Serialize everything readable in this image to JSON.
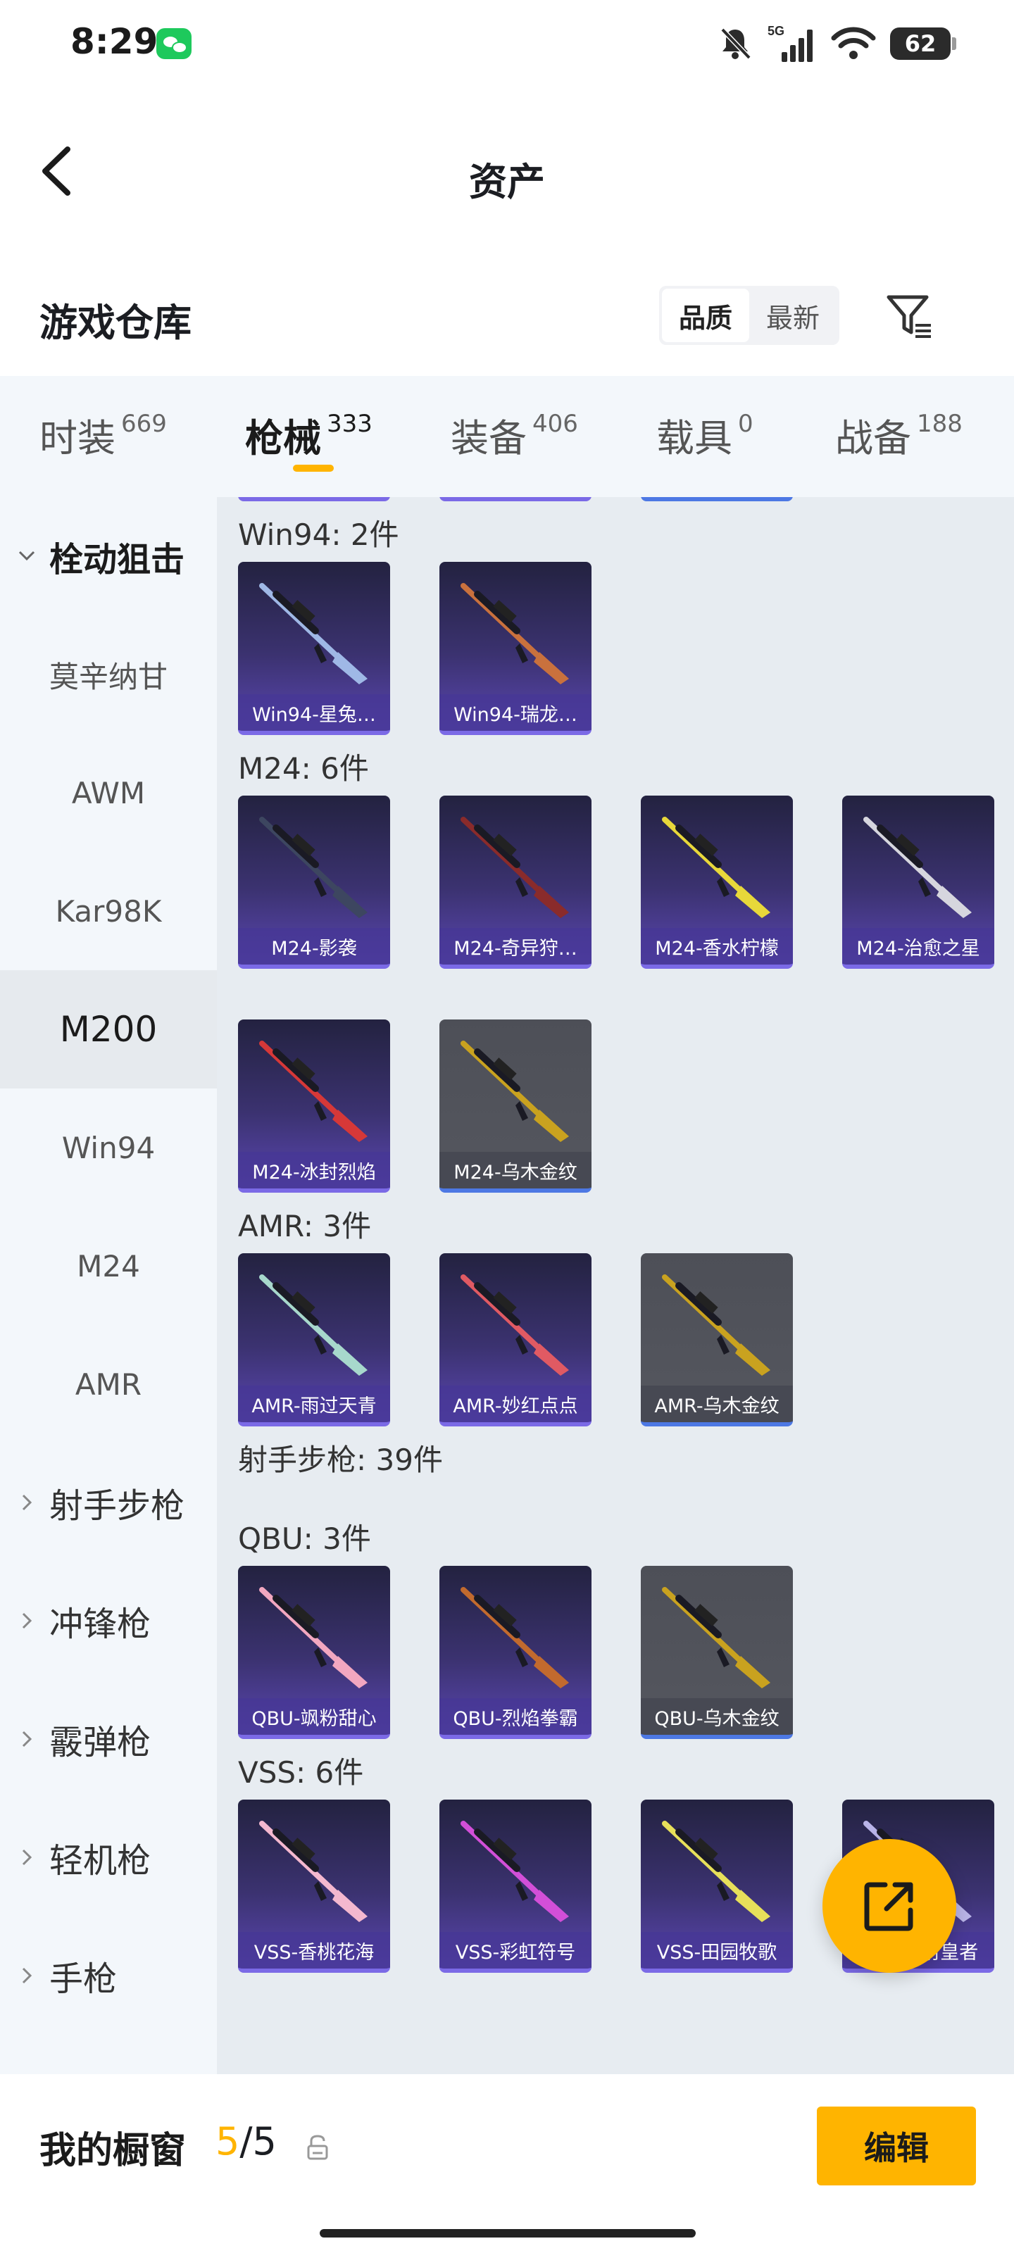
{
  "status": {
    "time": "8:29",
    "network": "5G",
    "battery": "62"
  },
  "nav": {
    "title": "资产"
  },
  "warehouse": {
    "title": "游戏仓库",
    "sort_options": [
      "品质",
      "最新"
    ],
    "sort_selected": "品质"
  },
  "category_tabs": [
    {
      "name": "时装",
      "count": "669"
    },
    {
      "name": "枪械",
      "count": "333",
      "active": true
    },
    {
      "name": "装备",
      "count": "406"
    },
    {
      "name": "载具",
      "count": "0"
    },
    {
      "name": "战备",
      "count": "188"
    }
  ],
  "sidebar": {
    "items": [
      {
        "label": "栓动狙击",
        "type": "group",
        "expanded": true
      },
      {
        "label": "莫辛纳甘"
      },
      {
        "label": "AWM"
      },
      {
        "label": "Kar98K"
      },
      {
        "label": "M200",
        "active": true
      },
      {
        "label": "Win94"
      },
      {
        "label": "M24"
      },
      {
        "label": "AMR"
      },
      {
        "label": "射手步枪",
        "type": "group"
      },
      {
        "label": "冲锋枪",
        "type": "group"
      },
      {
        "label": "霰弹枪",
        "type": "group"
      },
      {
        "label": "轻机枪",
        "type": "group"
      },
      {
        "label": "手枪",
        "type": "group"
      }
    ]
  },
  "content": {
    "groups": [
      {
        "label": "Win94: 2件",
        "items": [
          {
            "name": "Win94-星兔…",
            "rarity": "purple",
            "color": "#9fb8e6"
          },
          {
            "name": "Win94-瑞龙…",
            "rarity": "purple",
            "color": "#c9713d"
          }
        ]
      },
      {
        "label": "M24: 6件",
        "items": [
          {
            "name": "M24-影袭",
            "rarity": "purple",
            "color": "#3d4660"
          },
          {
            "name": "M24-奇异狩…",
            "rarity": "purple",
            "color": "#8a2b2b"
          },
          {
            "name": "M24-香水柠檬",
            "rarity": "purple",
            "color": "#e8d83a"
          },
          {
            "name": "M24-治愈之星",
            "rarity": "purple",
            "color": "#d6d6de"
          },
          {
            "name": "M24-冰封烈焰",
            "rarity": "purple",
            "color": "#d63838"
          },
          {
            "name": "M24-乌木金纹",
            "rarity": "black",
            "color": "#c9a21f"
          }
        ]
      },
      {
        "label": "AMR: 3件",
        "items": [
          {
            "name": "AMR-雨过天青",
            "rarity": "purple",
            "color": "#a7d8cc"
          },
          {
            "name": "AMR-妙红点点",
            "rarity": "purple",
            "color": "#e05a63"
          },
          {
            "name": "AMR-乌木金纹",
            "rarity": "black",
            "color": "#c9a21f"
          }
        ]
      },
      {
        "label": "射手步枪: 39件",
        "items": []
      },
      {
        "label": "QBU: 3件",
        "items": [
          {
            "name": "QBU-飒粉甜心",
            "rarity": "purple",
            "color": "#f2a7c0"
          },
          {
            "name": "QBU-烈焰拳霸",
            "rarity": "purple",
            "color": "#c26a2e"
          },
          {
            "name": "QBU-乌木金纹",
            "rarity": "black",
            "color": "#c9a21f"
          }
        ]
      },
      {
        "label": "VSS: 6件",
        "items": [
          {
            "name": "VSS-香桃花海",
            "rarity": "purple",
            "color": "#f4b8cf"
          },
          {
            "name": "VSS-彩虹符号",
            "rarity": "purple",
            "color": "#d24fd8"
          },
          {
            "name": "VSS-田园牧歌",
            "rarity": "purple",
            "color": "#e7e05a"
          },
          {
            "name": "VSS-镭射皇者",
            "rarity": "purple",
            "color": "#b9b4e8"
          }
        ]
      }
    ]
  },
  "bottom_bar": {
    "label": "我的橱窗",
    "showcase_current": "5",
    "showcase_total": "/5",
    "edit_label": "编辑"
  },
  "colors": {
    "accent": "#ffb400",
    "purple_card": "#5a46b0",
    "black_card": "#55575f"
  }
}
